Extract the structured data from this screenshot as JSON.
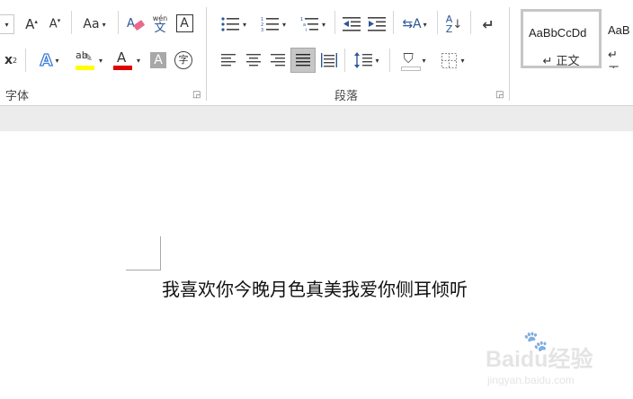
{
  "ribbon": {
    "font_group": {
      "label": "字体",
      "change_case": "Aa",
      "superscript": "x",
      "superscript_mark": "2",
      "phonetic_top": "wén",
      "phonetic_bottom": "文",
      "border_char": "A",
      "shading_char": "A",
      "font_color_char": "A",
      "encircle_char": "字",
      "highlight_text": "ab",
      "highlight_color": "#ffff00",
      "font_color": "#e00000"
    },
    "paragraph_group": {
      "label": "段落"
    },
    "styles": {
      "items": [
        {
          "sample": "AaBbCcDd",
          "name": "↵ 正文"
        },
        {
          "sample": "AaB",
          "name": "↵ 无"
        }
      ]
    }
  },
  "document": {
    "text": "我喜欢你今晚月色真美我爱你侧耳倾听"
  },
  "watermark": {
    "brand": "Baidu经验",
    "url": "jingyan.baidu.com"
  }
}
